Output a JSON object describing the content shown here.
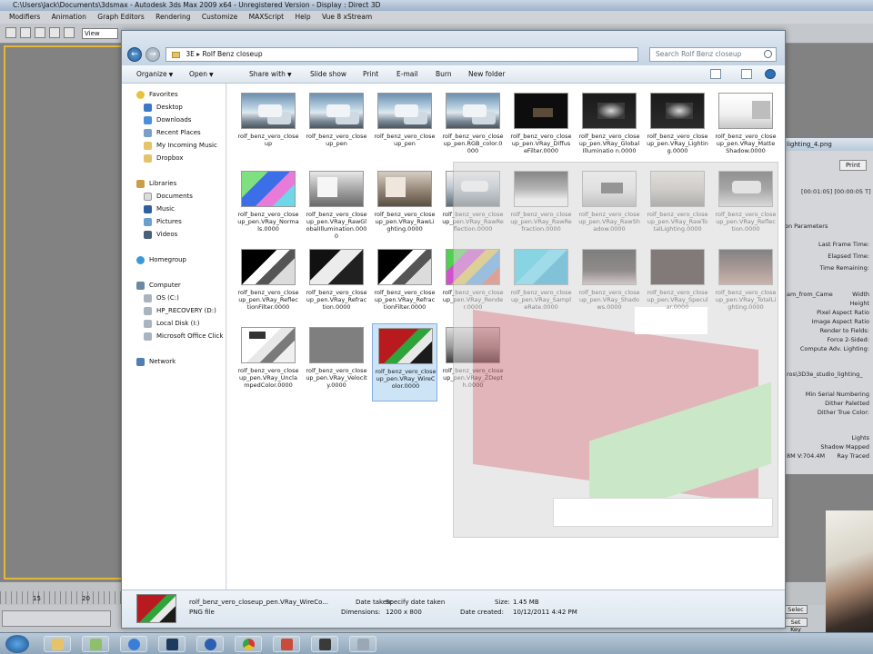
{
  "max": {
    "title": "C:\\Users\\Jack\\Documents\\3dsmax    - Autodesk 3ds Max  2009 x64   - Unregistered Version        - Display : Direct 3D",
    "menu": [
      "Modifiers",
      "Animation",
      "Graph Editors",
      "Rendering",
      "Customize",
      "MAXScript",
      "Help",
      "Vue 8 xStream"
    ],
    "view_select": "View",
    "timeline": {
      "tick_15": "15",
      "tick_20": "20"
    },
    "setkey": [
      "Selec",
      "Set Key"
    ]
  },
  "render_frame": {
    "title": "lighting_4.png",
    "button": "Print",
    "time": "[00:01:05] [00:00:05 T]",
    "section_params": "on Parameters",
    "last_frame_time": "Last Frame Time:",
    "elapsed_time": "Elapsed Time:",
    "time_remaining": "Time Remaining:",
    "camera": "am_from_Came",
    "width": "Width",
    "height": "Height",
    "pixel_aspect": "Pixel Aspect Ratio",
    "image_aspect": "Image Aspect Ratio",
    "render_fields": "Render to Fields:",
    "force_2sided": "Force 2-Sided:",
    "compute_adv": "Compute Adv. Lighting:",
    "file": "ros\\3D3e_studio_lighting_",
    "min_serial": "Min Serial Numbering",
    "dither_paletted": "Dither Paletted",
    "dither_true": "Dither True Color:",
    "lights": "Lights",
    "shadow_mapped": "Shadow Mapped",
    "memory": "8M V:704.4M",
    "ray_traced": "Ray Traced"
  },
  "explorer": {
    "address_parts": [
      "3E",
      "Rolf Benz closeup"
    ],
    "search_placeholder": "Search Rolf Benz closeup",
    "commands": {
      "organize": "Organize",
      "open": "Open",
      "share_with": "Share with",
      "slide_show": "Slide show",
      "print": "Print",
      "email": "E-mail",
      "burn": "Burn",
      "new_folder": "New folder"
    },
    "nav": {
      "favorites": "Favorites",
      "desktop": "Desktop",
      "downloads": "Downloads",
      "recent_places": "Recent Places",
      "incoming_music": "My Incoming Music",
      "dropbox": "Dropbox",
      "libraries": "Libraries",
      "documents": "Documents",
      "music": "Music",
      "pictures": "Pictures",
      "videos": "Videos",
      "homegroup": "Homegroup",
      "computer": "Computer",
      "os_c": "OS (C:)",
      "hp_recovery": "HP_RECOVERY (D:)",
      "local_disk": "Local Disk (I:)",
      "office_click": "Microsoft Office Click",
      "network": "Network"
    },
    "files": [
      {
        "label": "rolf_benz_vero_closeup"
      },
      {
        "label": "rolf_benz_vero_closeup_pen"
      },
      {
        "label": "rolf_benz_vero_closeup_pen"
      },
      {
        "label": "rolf_benz_vero_closeup_pen.RGB_color.0000"
      },
      {
        "label": "rolf_benz_vero_closeup_pen.VRay_DiffuseFilter.0000"
      },
      {
        "label": "rolf_benz_vero_closeup_pen.VRay_GlobalIlluminatio n.0000"
      },
      {
        "label": "rolf_benz_vero_closeup_pen.VRay_Lighting.0000"
      },
      {
        "label": "rolf_benz_vero_closeup_pen.VRay_MatteShadow.0000"
      },
      {
        "label": "rolf_benz_vero_closeup_pen.VRay_Normals.0000"
      },
      {
        "label": "rolf_benz_vero_closeup_pen.VRay_RawGlobalIllumination.0000"
      },
      {
        "label": "rolf_benz_vero_closeup_pen.VRay_RawLighting.0000"
      },
      {
        "label": "rolf_benz_vero_closeup_pen.VRay_RawReflection.0000"
      },
      {
        "label": "rolf_benz_vero_closeup_pen.VRay_RawRefraction.0000"
      },
      {
        "label": "rolf_benz_vero_closeup_pen.VRay_RawShadow.0000"
      },
      {
        "label": "rolf_benz_vero_closeup_pen.VRay_RawTotalLighting.0000"
      },
      {
        "label": "rolf_benz_vero_closeup_pen.VRay_Reflection.0000"
      },
      {
        "label": "rolf_benz_vero_closeup_pen.VRay_ReflectionFilter.0000"
      },
      {
        "label": "rolf_benz_vero_closeup_pen.VRay_Refraction.0000"
      },
      {
        "label": "rolf_benz_vero_closeup_pen.VRay_RefractionFilter.0000"
      },
      {
        "label": "rolf_benz_vero_closeup_pen.VRay_Render.0000"
      },
      {
        "label": "rolf_benz_vero_closeup_pen.VRay_SampleRate.0000"
      },
      {
        "label": "rolf_benz_vero_closeup_pen.VRay_Shadows.0000"
      },
      {
        "label": "rolf_benz_vero_closeup_pen.VRay_Specular.0000"
      },
      {
        "label": "rolf_benz_vero_closeup_pen.VRay_TotalLighting.0000"
      },
      {
        "label": "rolf_benz_vero_closeup_pen.VRay_UnclampedColor.0000"
      },
      {
        "label": "rolf_benz_vero_closeup_pen.VRay_Velocity.0000"
      },
      {
        "label": "rolf_benz_vero_closeup_pen.VRay_WireColor.0000"
      },
      {
        "label": "rolf_benz_vero_closeup_pen.VRay_ZDepth.0000"
      }
    ],
    "details": {
      "name": "rolf_benz_vero_closeup_pen.VRay_WireCo...",
      "type": "PNG file",
      "date_taken_label": "Date taken:",
      "date_taken_value": "Specify date taken",
      "dimensions_label": "Dimensions:",
      "dimensions_value": "1200 x 800",
      "size_label": "Size:",
      "size_value": "1.45 MB",
      "date_created_label": "Date created:",
      "date_created_value": "10/12/2011 4:42 PM"
    }
  },
  "colors": {
    "selection": "#cde4f7",
    "selection_border": "#84acdd",
    "viewport_frame": "#e2b83a"
  }
}
